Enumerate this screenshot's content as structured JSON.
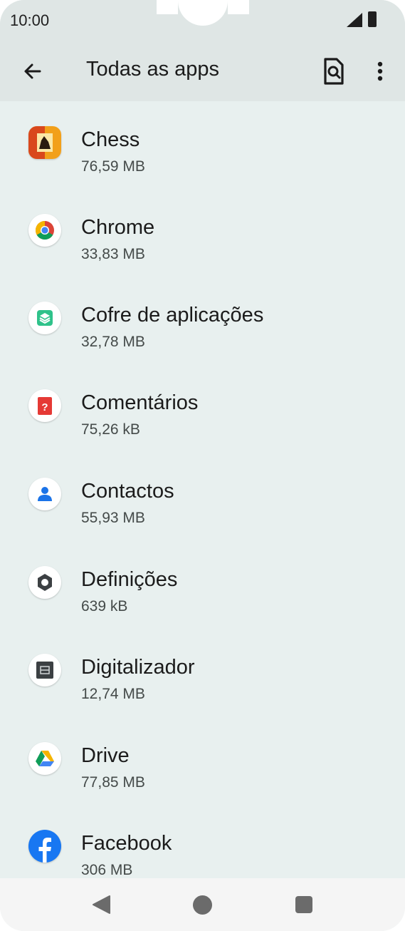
{
  "status_bar": {
    "time": "10:00"
  },
  "app_bar": {
    "title": "Todas as apps"
  },
  "apps": [
    {
      "name": "Chess",
      "size": "76,59 MB",
      "icon": "chess-icon"
    },
    {
      "name": "Chrome",
      "size": "33,83 MB",
      "icon": "chrome-icon"
    },
    {
      "name": "Cofre de aplicações",
      "size": "32,78 MB",
      "icon": "app-vault-icon"
    },
    {
      "name": "Comentários",
      "size": "75,26 kB",
      "icon": "feedback-icon"
    },
    {
      "name": "Contactos",
      "size": "55,93 MB",
      "icon": "contacts-icon"
    },
    {
      "name": "Definições",
      "size": "639 kB",
      "icon": "settings-icon"
    },
    {
      "name": "Digitalizador",
      "size": "12,74 MB",
      "icon": "scanner-icon"
    },
    {
      "name": "Drive",
      "size": "77,85 MB",
      "icon": "drive-icon"
    },
    {
      "name": "Facebook",
      "size": "306 MB",
      "icon": "facebook-icon"
    }
  ],
  "colors": {
    "background": "#e8f0ef",
    "app_bar": "#dfe6e5",
    "nav_bar": "#f5f5f5"
  }
}
